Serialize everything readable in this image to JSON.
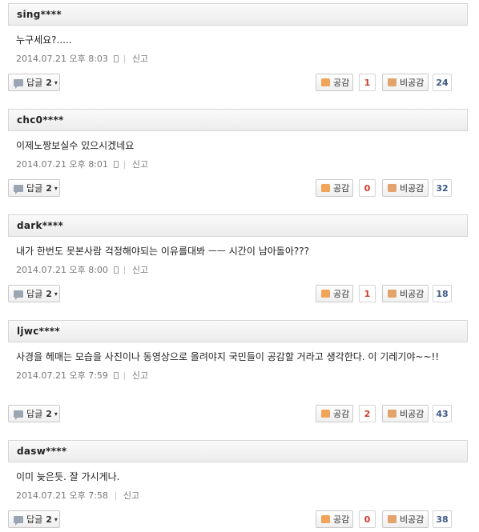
{
  "ui": {
    "reply_label": "답글",
    "like_label": "공감",
    "dislike_label": "비공감",
    "report_label": "신고",
    "reply_caret": "▾"
  },
  "comments": [
    {
      "user": "sing****",
      "text": "누구세요?.....",
      "time": "2014.07.21 오후 8:03",
      "replies": "2",
      "likes": "1",
      "dislikes": "24"
    },
    {
      "user": "chc0****",
      "text": "이제노짱보실수 있으시겠네요",
      "time": "2014.07.21 오후 8:01",
      "replies": "2",
      "likes": "0",
      "dislikes": "32"
    },
    {
      "user": "dark****",
      "text": "내가 한번도 못본사람 걱정해야되는 이유를대봐 ㅡㅡ 시간이 남아돌아???",
      "time": "2014.07.21 오후 8:00",
      "replies": "2",
      "likes": "1",
      "dislikes": "18"
    },
    {
      "user": "ljwc****",
      "text": "사경을 헤매는 모습을 사진이나 동영상으로 올려야지 국민들이 공감할 거라고 생각한다. 이 기레기야~~!!",
      "time": "2014.07.21 오후 7:59",
      "replies": "2",
      "likes": "2",
      "dislikes": "43"
    },
    {
      "user": "dasw****",
      "text": "이미 늦은듯. 잘 가시게나.",
      "time": "2014.07.21 오후 7:58",
      "replies": "2",
      "likes": "0",
      "dislikes": "38"
    }
  ]
}
